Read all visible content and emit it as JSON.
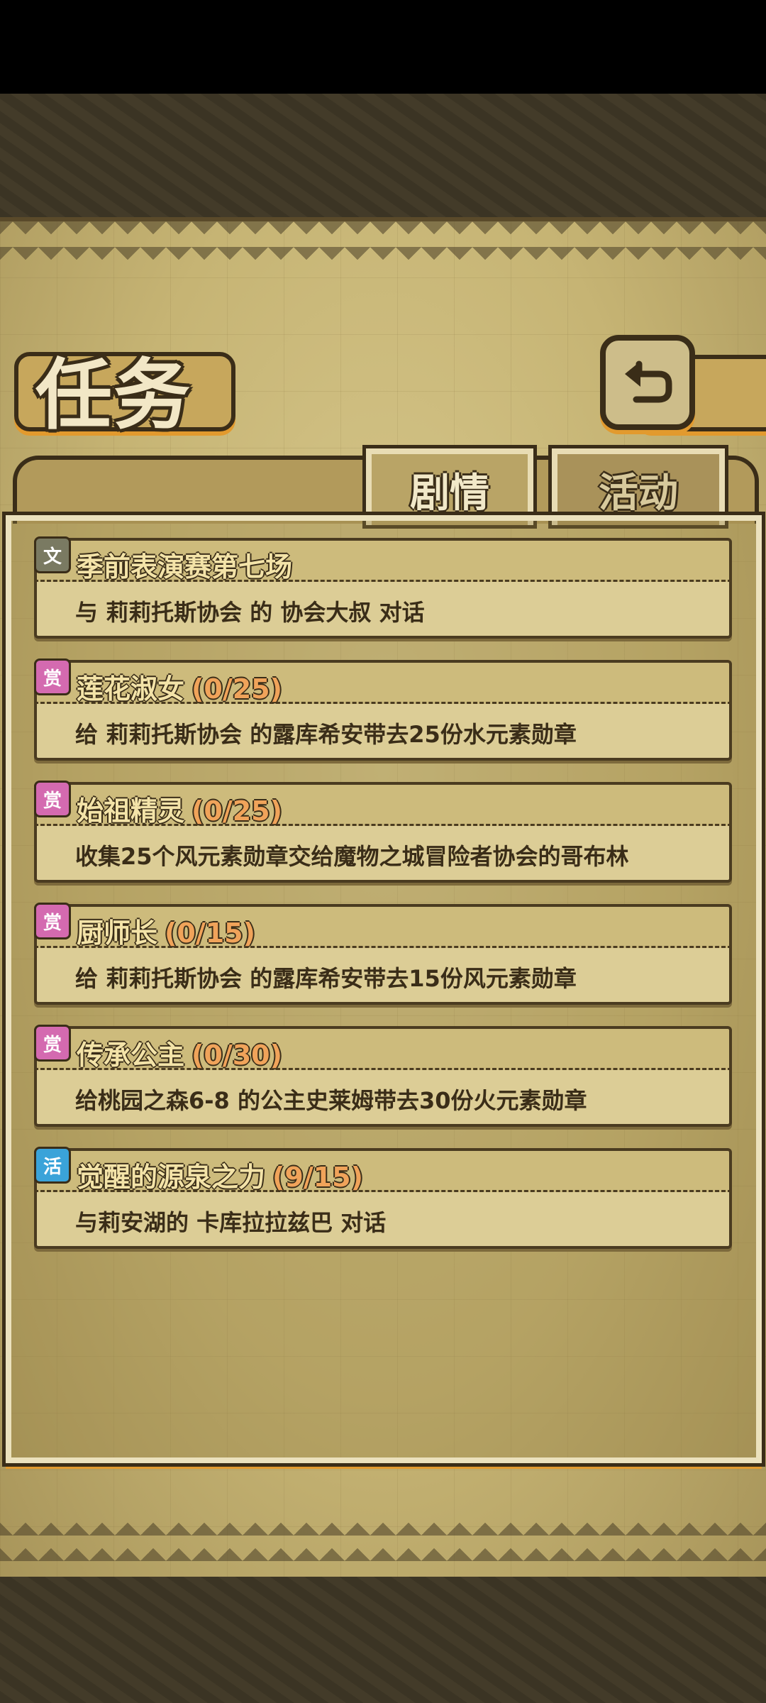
{
  "page": {
    "title": "任务"
  },
  "tabs": [
    {
      "label": "剧情",
      "active": true
    },
    {
      "label": "活动",
      "active": false
    }
  ],
  "colors": {
    "badge_story": "#7a7a62",
    "badge_reward": "#d46ab0",
    "badge_event": "#3aa3d9"
  },
  "quests": [
    {
      "badge": "文",
      "badge_type": "story",
      "title": "季前表演赛第七场",
      "progress": "",
      "desc": "与 莉莉托斯协会 的 协会大叔 对话"
    },
    {
      "badge": "赏",
      "badge_type": "reward",
      "title": "莲花淑女",
      "progress": "(0/25)",
      "desc": "给 莉莉托斯协会 的露库希安带去25份水元素勋章"
    },
    {
      "badge": "赏",
      "badge_type": "reward",
      "title": "始祖精灵",
      "progress": "(0/25)",
      "desc": "收集25个风元素勋章交给魔物之城冒险者协会的哥布林"
    },
    {
      "badge": "赏",
      "badge_type": "reward",
      "title": "厨师长",
      "progress": "(0/15)",
      "desc": "给 莉莉托斯协会 的露库希安带去15份风元素勋章"
    },
    {
      "badge": "赏",
      "badge_type": "reward",
      "title": "传承公主",
      "progress": "(0/30)",
      "desc": "给桃园之森6-8 的公主史莱姆带去30份火元素勋章"
    },
    {
      "badge": "活",
      "badge_type": "event",
      "title": "觉醒的源泉之力",
      "progress": "(9/15)",
      "desc": "与莉安湖的 卡库拉拉兹巴 对话"
    }
  ]
}
